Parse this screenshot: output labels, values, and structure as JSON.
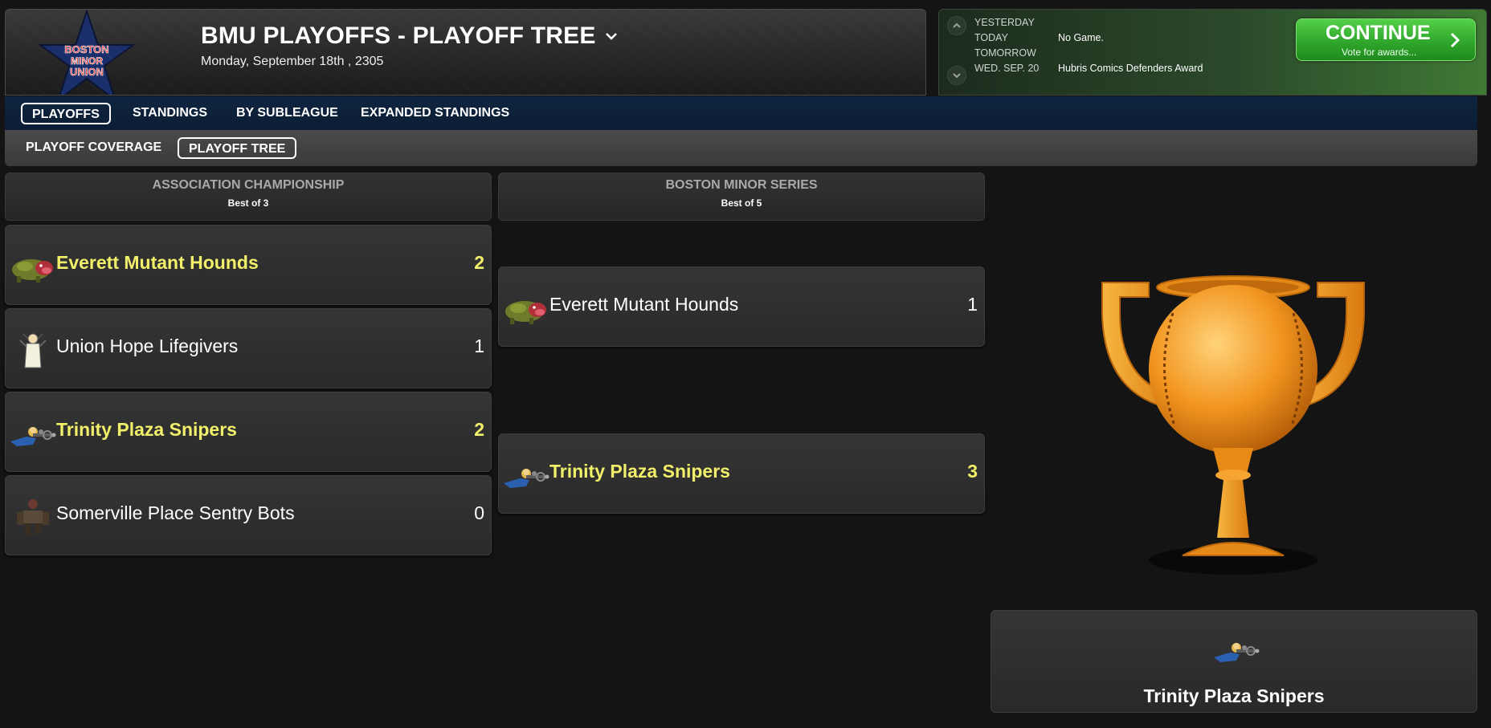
{
  "header": {
    "logo_text": [
      "BOSTON",
      "MINOR",
      "UNION"
    ],
    "title": "BMU PLAYOFFS - PLAYOFF TREE",
    "date": "Monday, September 18th , 2305"
  },
  "schedule": {
    "rows": [
      {
        "day": "YESTERDAY",
        "value": ""
      },
      {
        "day": "TODAY",
        "value": "No Game."
      },
      {
        "day": "TOMORROW",
        "value": ""
      },
      {
        "day": "WED. SEP. 20",
        "value": "Hubris Comics Defenders Award"
      }
    ],
    "continue_label": "CONTINUE",
    "continue_sub": "Vote for awards..."
  },
  "nav": {
    "primary": [
      "PLAYOFFS",
      "STANDINGS",
      "BY SUBLEAGUE",
      "EXPANDED STANDINGS"
    ],
    "secondary": [
      "PLAYOFF COVERAGE",
      "PLAYOFF TREE"
    ]
  },
  "rounds": [
    {
      "title": "ASSOCIATION CHAMPIONSHIP",
      "subtitle": "Best of 3",
      "teams": [
        {
          "name": "Everett Mutant Hounds",
          "score": "2",
          "winner": true,
          "icon": "hound-icon"
        },
        {
          "name": "Union Hope Lifegivers",
          "score": "1",
          "winner": false,
          "icon": "lifegiver-icon"
        },
        {
          "name": "Trinity Plaza Snipers",
          "score": "2",
          "winner": true,
          "icon": "sniper-icon"
        },
        {
          "name": "Somerville Place Sentry Bots",
          "score": "0",
          "winner": false,
          "icon": "sentry-bot-icon"
        }
      ]
    },
    {
      "title": "BOSTON MINOR SERIES",
      "subtitle": "Best of 5",
      "teams": [
        {
          "name": "Everett Mutant Hounds",
          "score": "1",
          "winner": false,
          "icon": "hound-icon"
        },
        {
          "name": "Trinity Plaza Snipers",
          "score": "3",
          "winner": true,
          "icon": "sniper-icon"
        }
      ]
    }
  ],
  "champion": {
    "name": "Trinity Plaza Snipers",
    "icon": "sniper-icon"
  },
  "colors": {
    "winner": "#f2f06a",
    "continue": "#2ea42a",
    "nav": "#0f2540"
  }
}
